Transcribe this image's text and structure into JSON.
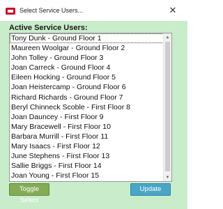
{
  "window": {
    "title": "Select Service Users...",
    "close_glyph": "✕"
  },
  "heading": "Active Service Users:",
  "service_users": [
    "Tony Dunk - Ground Floor 1",
    "Maureen Woolgar - Ground Floor 2",
    "John Tolley - Ground Floor 3",
    "Joan Carreck - Ground Floor 4",
    "Eileen Hocking - Ground Floor 5",
    "Joan Heistercamp - Ground Floor 6",
    "Richard Richards - Ground Floor 7",
    "Beryl Chinneck Scoble - First Floor 8",
    "Joan Dauncey - First Floor 9",
    "Mary Bracewell - First Floor 10",
    "Barbara Murrill - First Floor 11",
    "Mary Isaacs - First Floor 12",
    "June Stephens - First Floor 13",
    "Sallie Briggs - First Floor 14",
    "Joan Young - First Floor 15"
  ],
  "scrollbar": {
    "up_glyph": "▲",
    "down_glyph": "▼"
  },
  "buttons": {
    "toggle_label": "Toggle Select",
    "update_label": "Update"
  },
  "colors": {
    "background": "#c9eccb",
    "toggle_button": "#84ac56",
    "update_button": "#4aa6c7"
  }
}
